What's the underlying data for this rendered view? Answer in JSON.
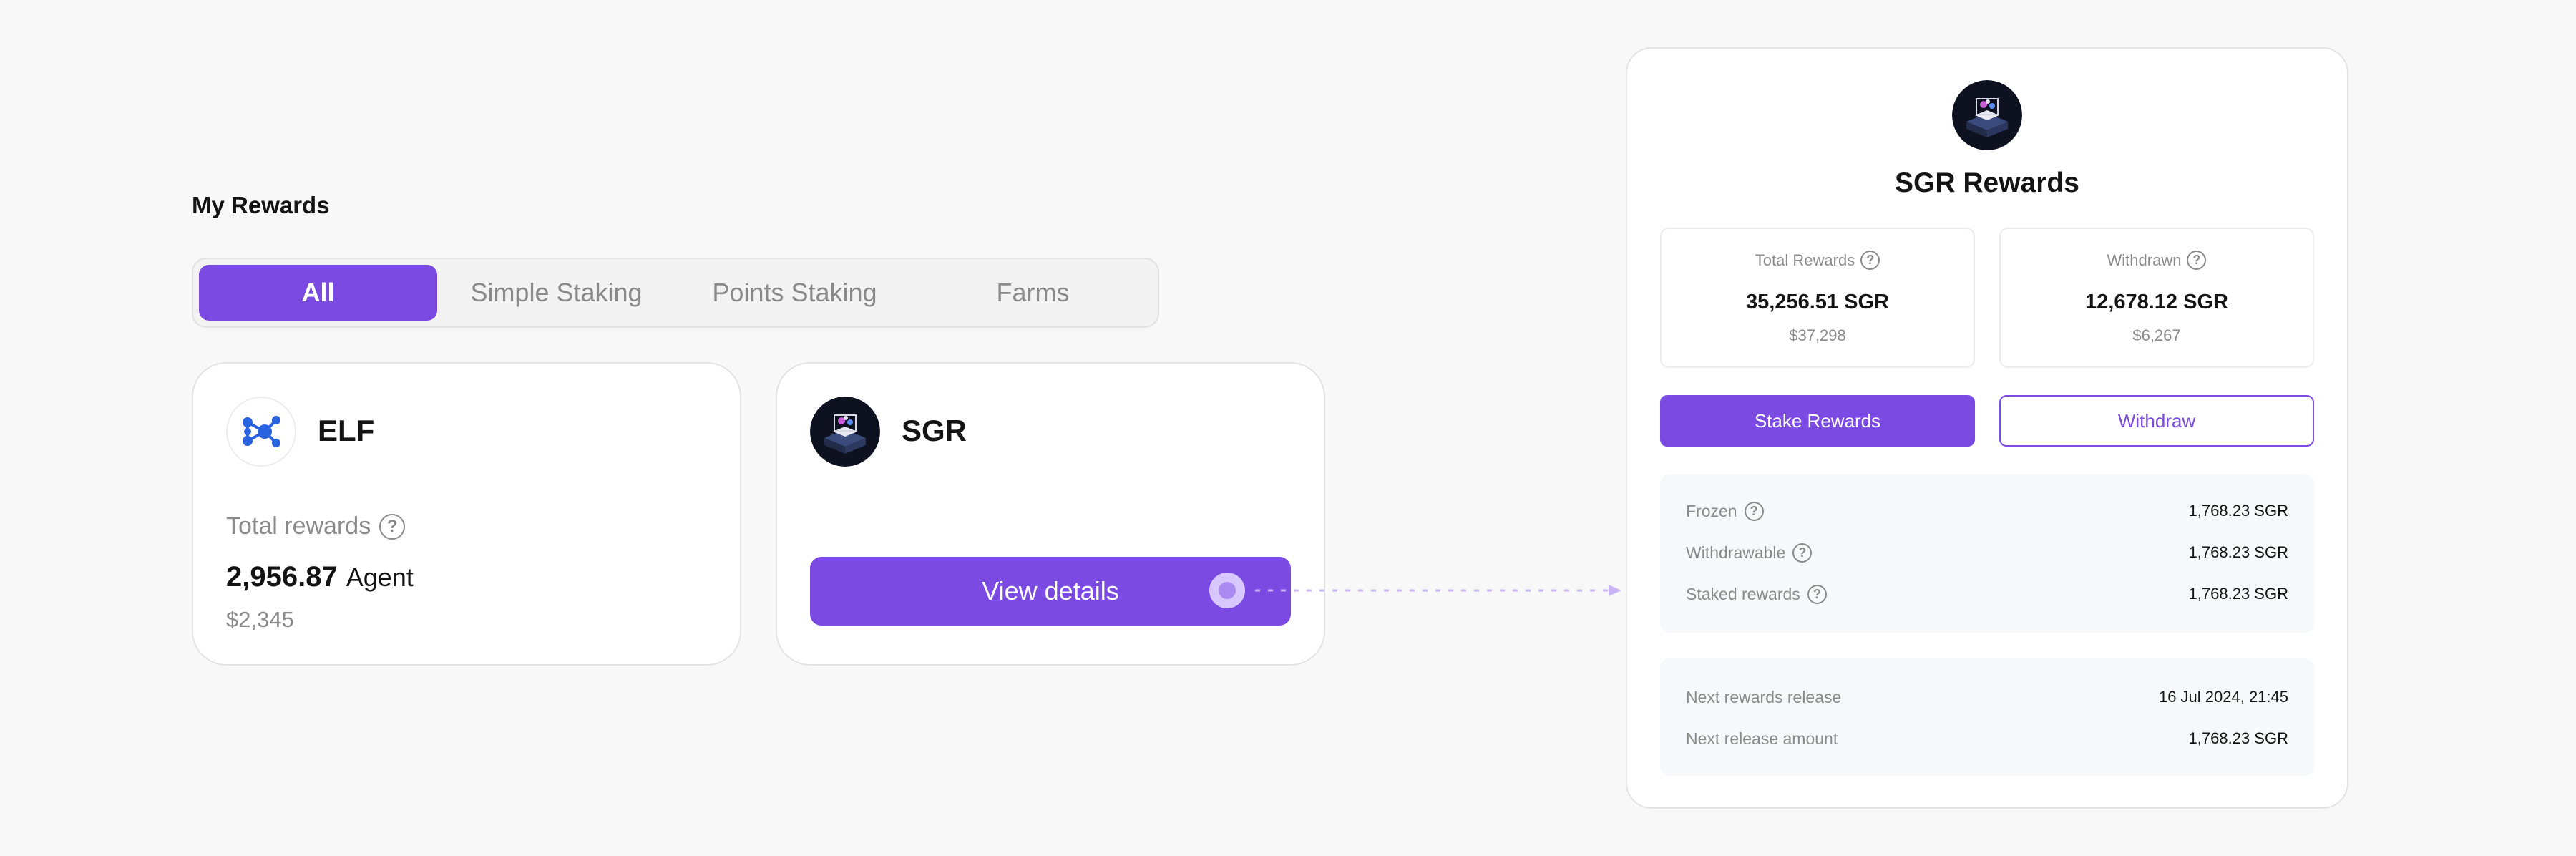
{
  "page": {
    "title": "My Rewards"
  },
  "tabs": [
    {
      "label": "All",
      "active": true
    },
    {
      "label": "Simple Staking",
      "active": false
    },
    {
      "label": "Points Staking",
      "active": false
    },
    {
      "label": "Farms",
      "active": false
    }
  ],
  "cards": {
    "elf": {
      "name": "ELF",
      "icon": "elf-logo-icon",
      "total_label": "Total rewards",
      "amount": "2,956.87",
      "unit": "Agent",
      "usd": "$2,345"
    },
    "sgr": {
      "name": "SGR",
      "icon": "sgr-logo-icon",
      "button_label": "View details"
    }
  },
  "panel": {
    "title": "SGR Rewards",
    "total": {
      "label": "Total Rewards",
      "value": "35,256.51 SGR",
      "usd": "$37,298"
    },
    "withdrawn": {
      "label": "Withdrawn",
      "value": "12,678.12 SGR",
      "usd": "$6,267"
    },
    "stake_button": "Stake Rewards",
    "withdraw_button": "Withdraw",
    "details": [
      {
        "label": "Frozen",
        "value": "1,768.23 SGR"
      },
      {
        "label": "Withdrawable",
        "value": "1,768.23 SGR"
      },
      {
        "label": "Staked rewards",
        "value": "1,768.23 SGR"
      }
    ],
    "release": [
      {
        "label": "Next rewards release",
        "value": "16 Jul 2024, 21:45"
      },
      {
        "label": "Next release amount",
        "value": "1,768.23 SGR"
      }
    ]
  },
  "colors": {
    "accent": "#7b4ae2",
    "elf_blue": "#2a63e0"
  }
}
